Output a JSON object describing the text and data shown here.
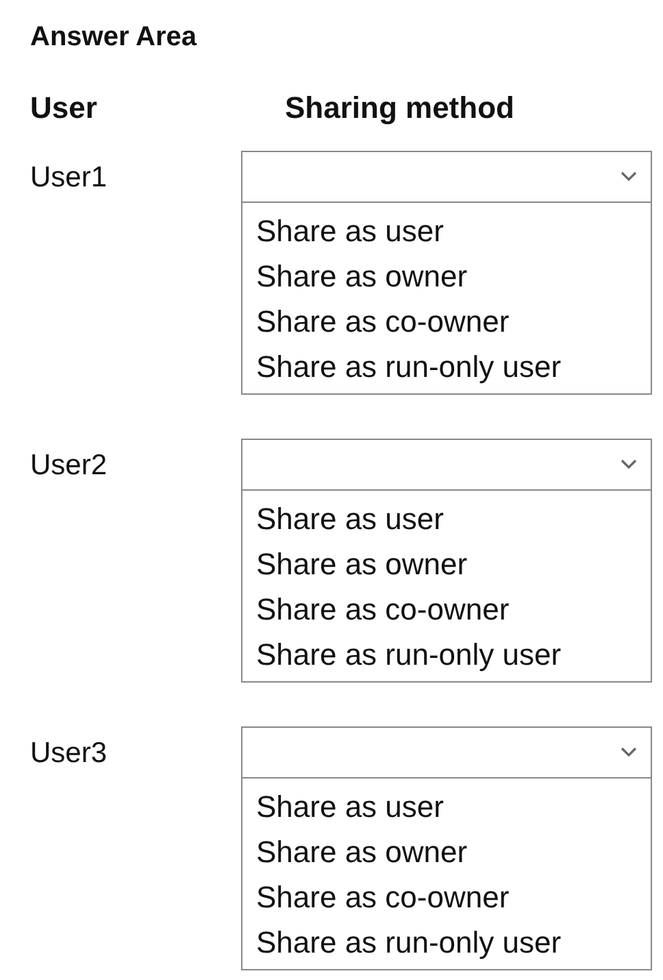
{
  "title": "Answer Area",
  "columns": [
    "User",
    "Sharing method"
  ],
  "rows": [
    {
      "user": "User1",
      "options": [
        "Share as user",
        "Share as owner",
        "Share as co-owner",
        "Share as run-only user"
      ]
    },
    {
      "user": "User2",
      "options": [
        "Share as user",
        "Share as owner",
        "Share as co-owner",
        "Share as run-only user"
      ]
    },
    {
      "user": "User3",
      "options": [
        "Share as user",
        "Share as owner",
        "Share as co-owner",
        "Share as run-only user"
      ]
    }
  ]
}
